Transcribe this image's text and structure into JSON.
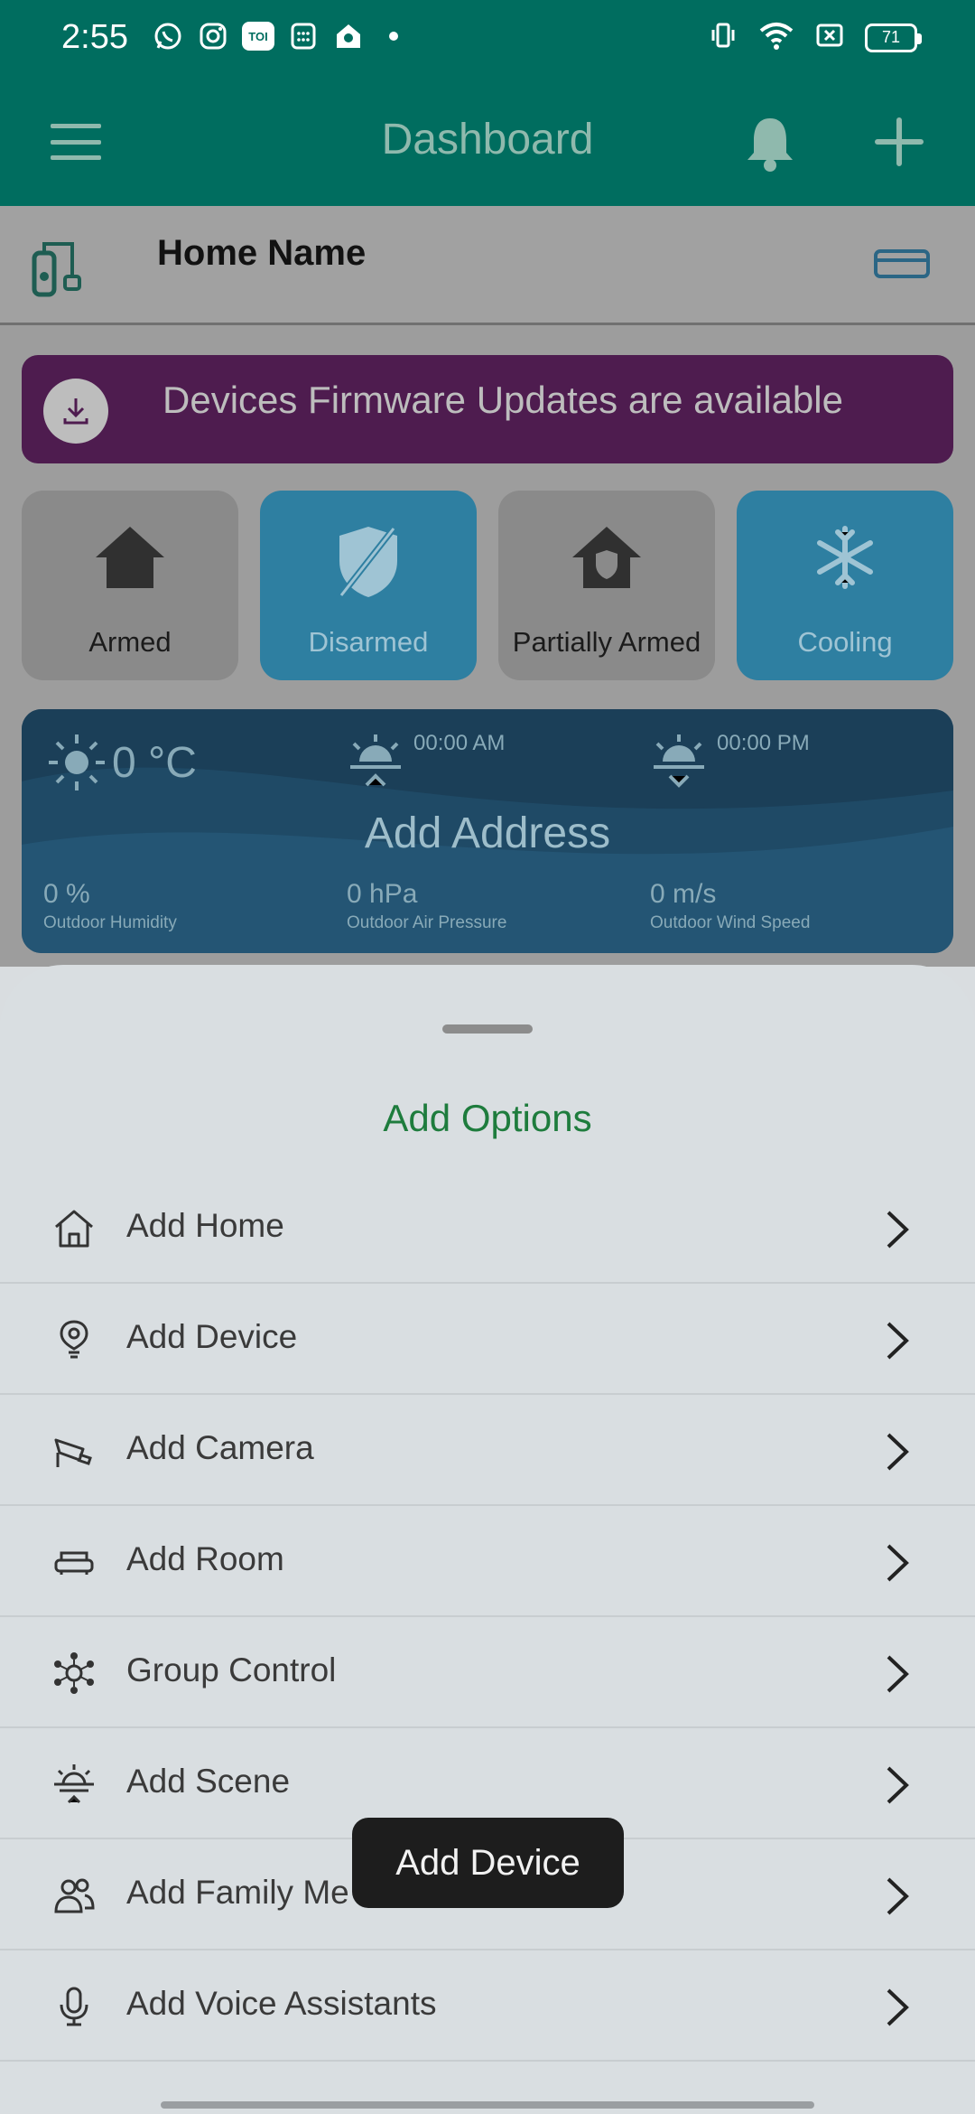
{
  "status_bar": {
    "time": "2:55",
    "battery": "71",
    "notif_icons": [
      "whatsapp-icon",
      "instagram-icon",
      "toi-icon",
      "calculator-icon",
      "home-app-icon",
      "dot-icon"
    ],
    "toi_label": "TOI"
  },
  "app_bar": {
    "title": "Dashboard"
  },
  "home": {
    "name": "Home Name"
  },
  "firmware_banner": {
    "text": "Devices Firmware Updates are available"
  },
  "modes": [
    {
      "label": "Armed",
      "icon": "home-icon",
      "active": false
    },
    {
      "label": "Disarmed",
      "icon": "shield-off-icon",
      "active": true
    },
    {
      "label": "Partially Armed",
      "icon": "home-shield-icon",
      "active": false
    },
    {
      "label": "Cooling",
      "icon": "snowflake-icon",
      "active": true
    }
  ],
  "weather": {
    "temperature": "0 °C",
    "sunrise": "00:00 AM",
    "sunset": "00:00 PM",
    "address": "Add Address",
    "humidity_value": "0 %",
    "humidity_label": "Outdoor Humidity",
    "pressure_value": "0 hPa",
    "pressure_label": "Outdoor Air Pressure",
    "wind_value": "0 m/s",
    "wind_label": "Outdoor Wind Speed"
  },
  "sheet": {
    "title": "Add Options",
    "options": [
      {
        "label": "Add Home",
        "icon": "home-outline-icon"
      },
      {
        "label": "Add Device",
        "icon": "device-pin-icon"
      },
      {
        "label": "Add Camera",
        "icon": "camera-cctv-icon"
      },
      {
        "label": "Add Room",
        "icon": "sofa-icon"
      },
      {
        "label": "Group Control",
        "icon": "network-icon"
      },
      {
        "label": "Add Scene",
        "icon": "sunrise-icon"
      },
      {
        "label": "Add Family Me",
        "icon": "people-icon"
      },
      {
        "label": "Add Voice Assistants",
        "icon": "microphone-icon"
      }
    ]
  },
  "toast": {
    "text": "Add Device"
  },
  "colors": {
    "app_bar": "#006d5f",
    "sheet_title": "#1e7c3d",
    "banner": "#4e1c4f",
    "active_mode": "#2e7fa1"
  }
}
